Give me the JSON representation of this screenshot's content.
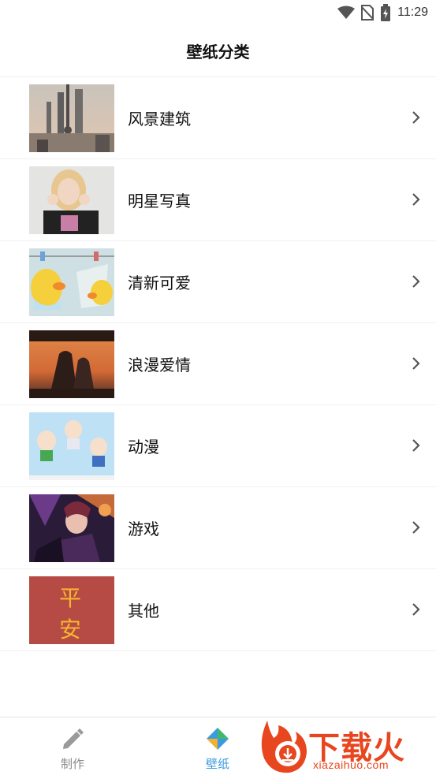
{
  "status": {
    "time": "11:29"
  },
  "header": {
    "title": "壁纸分类"
  },
  "categories": [
    {
      "label": "风景建筑"
    },
    {
      "label": "明星写真"
    },
    {
      "label": "清新可爱"
    },
    {
      "label": "浪漫爱情"
    },
    {
      "label": "动漫"
    },
    {
      "label": "游戏"
    },
    {
      "label": "其他",
      "thumb_text_1": "平",
      "thumb_text_2": "安"
    }
  ],
  "bottom_nav": {
    "items": [
      {
        "label": "制作",
        "icon": "pencil-icon",
        "active": false
      },
      {
        "label": "壁纸",
        "icon": "pinwheel-icon",
        "active": true
      }
    ]
  },
  "watermark": {
    "brand": "下载火",
    "url": "xiazaihuo.com"
  },
  "colors": {
    "active_tab": "#3a9be0",
    "inactive_tab": "#888888",
    "watermark": "#e8461e"
  }
}
